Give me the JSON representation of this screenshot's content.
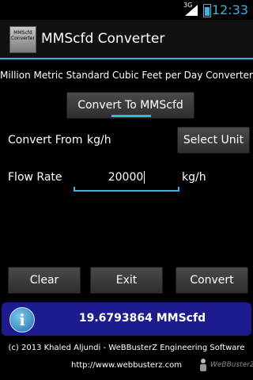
{
  "status_bar": {
    "network_label": "3G",
    "time": "12:33"
  },
  "action_bar": {
    "app_icon_label": "MMScfd Converter",
    "title": "MMScfd Converter"
  },
  "subtitle": "Million Metric Standard Cubic Feet per Day Converter",
  "convert_to_button": "Convert To MMScfd",
  "convert_from": {
    "label": "Convert From",
    "unit": "kg/h",
    "select_button": "Select Unit"
  },
  "flow_rate": {
    "label": "Flow Rate",
    "value": "20000",
    "unit": "kg/h"
  },
  "buttons": {
    "clear": "Clear",
    "exit": "Exit",
    "convert": "Convert"
  },
  "result": {
    "value": "19.6793864 MMScfd"
  },
  "footer": {
    "copyright": "(c) 2013 Khaled Aljundi - WeBBusterZ Engineering Software",
    "website": "http://www.webbusterz.com",
    "watermark": "WeBBusterZ"
  },
  "colors": {
    "accent": "#33b5e5",
    "result_background": "#1c1c8e",
    "background": "#000000"
  }
}
